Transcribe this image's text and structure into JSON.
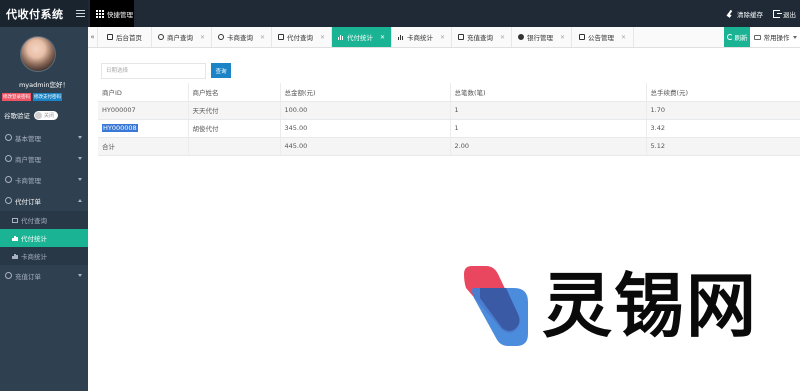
{
  "header": {
    "app_title": "代收付系统",
    "quick_menu_label": "快捷管理",
    "clear_cache_label": "清除缓存",
    "logout_label": "退出"
  },
  "sidebar": {
    "greeting": "myadmin您好！",
    "change_login_pwd": "修改登录密码",
    "change_pay_pwd": "修改支付密码",
    "google_verify_label": "谷歌验证",
    "toggle_text": "关闭",
    "menu": [
      {
        "label": "基本管理",
        "icon": "gear-icon",
        "expanded": false
      },
      {
        "label": "商户管理",
        "icon": "user-icon",
        "expanded": false
      },
      {
        "label": "卡商管理",
        "icon": "users-icon",
        "expanded": false
      },
      {
        "label": "代付订单",
        "icon": "edit-icon",
        "expanded": true
      },
      {
        "label": "充值订单",
        "icon": "file-icon",
        "expanded": false
      }
    ],
    "submenu": [
      {
        "label": "代付查询",
        "icon": "list-icon",
        "active": false
      },
      {
        "label": "代付统计",
        "icon": "bar-chart-icon",
        "active": true
      },
      {
        "label": "卡商统计",
        "icon": "bar-chart-icon",
        "active": false
      }
    ]
  },
  "tabs": [
    {
      "label": "后台首页",
      "icon": "home-icon",
      "closable": false,
      "active": false
    },
    {
      "label": "商户查询",
      "icon": "user-icon",
      "closable": true,
      "active": false
    },
    {
      "label": "卡商查询",
      "icon": "users-icon",
      "closable": true,
      "active": false
    },
    {
      "label": "代付查询",
      "icon": "list-icon",
      "closable": true,
      "active": false
    },
    {
      "label": "代付统计",
      "icon": "bar-chart-icon",
      "closable": true,
      "active": true
    },
    {
      "label": "卡商统计",
      "icon": "bar-chart-icon",
      "closable": true,
      "active": false
    },
    {
      "label": "充值查询",
      "icon": "check-icon",
      "closable": true,
      "active": false
    },
    {
      "label": "银行管理",
      "icon": "circle-icon",
      "closable": true,
      "active": false
    },
    {
      "label": "公告管理",
      "icon": "calendar-icon",
      "closable": true,
      "active": false
    }
  ],
  "tabbar_right": {
    "refresh_label": "刷新",
    "ops_label": "常用操作"
  },
  "search": {
    "date_placeholder": "日期选择",
    "query_label": "查询"
  },
  "table": {
    "columns": [
      "商户ID",
      "商户姓名",
      "总金额(元)",
      "总笔数(笔)",
      "总手续费(元)"
    ],
    "rows": [
      [
        "HY000007",
        "天天代付",
        "100.00",
        "1",
        "1.70"
      ],
      [
        "HY000008",
        "胡俊代付",
        "345.00",
        "1",
        "3.42"
      ],
      [
        "合计",
        "",
        "445.00",
        "2.00",
        "5.12"
      ]
    ],
    "selected_cell": "HY000008"
  },
  "watermark": {
    "text": "灵锡网",
    "colors": {
      "red": "#e8475f",
      "blue": "#3d82d9",
      "overlap": "#3b5aa6"
    }
  },
  "colors": {
    "accent": "#1ab394",
    "sidebar_bg": "#2f4050",
    "topbar_bg": "#1f2a36",
    "primary_btn": "#1c84c6",
    "danger_btn": "#ed5565"
  }
}
